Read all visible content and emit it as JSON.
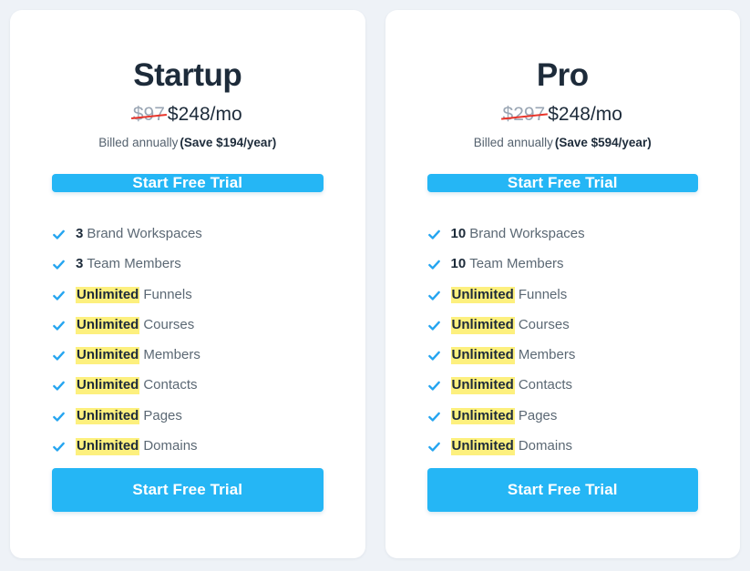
{
  "theme": {
    "page_background": "#eef2f7",
    "card_background": "#ffffff",
    "accent_blue": "#25b6f5",
    "check_blue": "#25a5f0",
    "highlight_yellow": "#fdf07e",
    "strikethrough_red": "#e8342a",
    "heading_navy": "#1d2b3a",
    "body_gray": "#5b6874",
    "old_price_gray": "#9aa6b4"
  },
  "plans": [
    {
      "name": "Startup",
      "old_price": "$97",
      "new_price": "$248/mo",
      "billing_period": "Billed annually",
      "savings": "(Save $194/year)",
      "cta_top_label": "Start Free Trial",
      "cta_bottom_label": "Start Free Trial",
      "features": [
        {
          "qty": "3",
          "label": "Brand Workspaces",
          "highlighted": false
        },
        {
          "qty": "3",
          "label": "Team Members",
          "highlighted": false
        },
        {
          "qty": "Unlimited",
          "label": "Funnels",
          "highlighted": true
        },
        {
          "qty": "Unlimited",
          "label": "Courses",
          "highlighted": true
        },
        {
          "qty": "Unlimited",
          "label": "Members",
          "highlighted": true
        },
        {
          "qty": "Unlimited",
          "label": "Contacts",
          "highlighted": true
        },
        {
          "qty": "Unlimited",
          "label": "Pages",
          "highlighted": true
        },
        {
          "qty": "Unlimited",
          "label": "Domains",
          "highlighted": true
        }
      ]
    },
    {
      "name": "Pro",
      "old_price": "$297",
      "new_price": "$248/mo",
      "billing_period": "Billed annually",
      "savings": "(Save $594/year)",
      "cta_top_label": "Start Free Trial",
      "cta_bottom_label": "Start Free Trial",
      "features": [
        {
          "qty": "10",
          "label": "Brand Workspaces",
          "highlighted": false
        },
        {
          "qty": "10",
          "label": "Team Members",
          "highlighted": false
        },
        {
          "qty": "Unlimited",
          "label": "Funnels",
          "highlighted": true
        },
        {
          "qty": "Unlimited",
          "label": "Courses",
          "highlighted": true
        },
        {
          "qty": "Unlimited",
          "label": "Members",
          "highlighted": true
        },
        {
          "qty": "Unlimited",
          "label": "Contacts",
          "highlighted": true
        },
        {
          "qty": "Unlimited",
          "label": "Pages",
          "highlighted": true
        },
        {
          "qty": "Unlimited",
          "label": "Domains",
          "highlighted": true
        }
      ]
    }
  ]
}
